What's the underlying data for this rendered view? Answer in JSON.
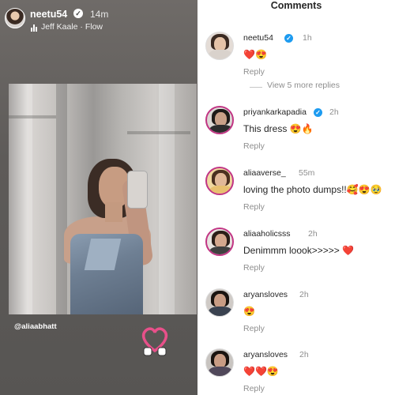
{
  "story": {
    "username": "neetu54",
    "time": "14m",
    "music": "Jeff Kaale · Flow",
    "mention": "@aliaabhatt"
  },
  "comments_panel": {
    "title": "Comments",
    "reply_label": "Reply",
    "view_more": "View 5 more replies",
    "items": [
      {
        "user": "neetu54",
        "verified": true,
        "time": "1h",
        "text": "❤️😍"
      },
      {
        "user": "priyankarkapadia",
        "verified": true,
        "time": "2h",
        "text": "This dress 😍🔥"
      },
      {
        "user": "aliaaverse_",
        "verified": false,
        "time": "55m",
        "text": "loving the photo dumps!!🥰😍🥹"
      },
      {
        "user": "aliaaholicsss",
        "verified": false,
        "time": "2h",
        "text": "Denimmm loook>>>>> ❤️"
      },
      {
        "user": "aryansloves",
        "verified": false,
        "time": "2h",
        "text": "😍"
      },
      {
        "user": "aryansloves",
        "verified": false,
        "time": "2h",
        "text": "❤️❤️😍"
      }
    ]
  },
  "colors": {
    "story_bg": "#5e5b59",
    "verified_blue": "#1d9bf0",
    "muted_text": "#8e8e8e",
    "story_ring": "#c13584"
  }
}
